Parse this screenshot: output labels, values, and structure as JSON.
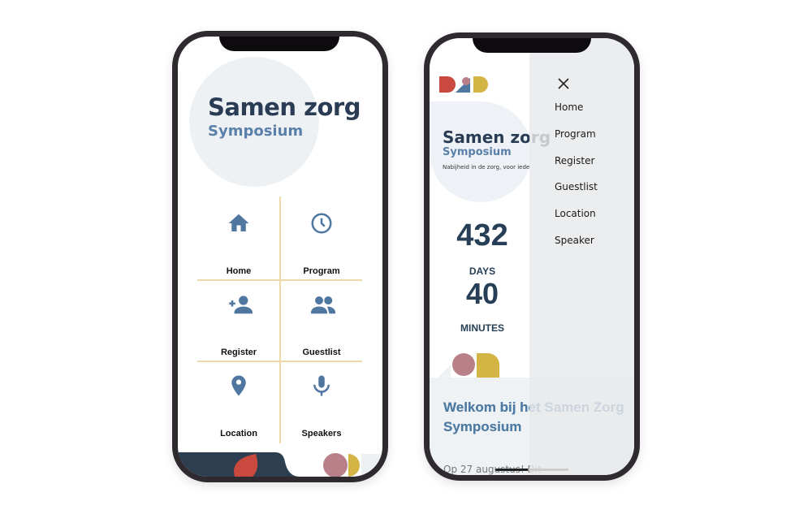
{
  "left_phone": {
    "title": "Samen zorg",
    "subtitle": "Symposium",
    "tiles": [
      {
        "label": "Home",
        "icon": "home-icon"
      },
      {
        "label": "Program",
        "icon": "clock-icon"
      },
      {
        "label": "Register",
        "icon": "add-person-icon"
      },
      {
        "label": "Guestlist",
        "icon": "people-icon"
      },
      {
        "label": "Location",
        "icon": "map-pin-icon"
      },
      {
        "label": "Speakers",
        "icon": "microphone-icon"
      }
    ]
  },
  "right_phone": {
    "title": "Samen zorg",
    "subtitle": "Symposium",
    "tagline": "Nabijheid in de zorg, voor iede",
    "countdown": {
      "days_value": "432",
      "days_label": "DAYS",
      "minutes_value": "40",
      "minutes_label": "MINUTES"
    },
    "welcome": "Welkom bij het Samen Zorg Symposium",
    "welcome_line1": "Welkom bij het",
    "welcome_line2": "Symposium",
    "intro": "Op 27 augustus! Dit",
    "menu": {
      "close_icon": "close-icon",
      "items": [
        "Home",
        "Program",
        "Register",
        "Guestlist",
        "Location",
        "Speaker"
      ]
    }
  },
  "colors": {
    "navy": "#293c54",
    "blue": "#5a80a9",
    "red": "#c9493f",
    "pink": "#b98089",
    "yellow": "#d4b445",
    "gold_line": "#ecd9a8"
  }
}
